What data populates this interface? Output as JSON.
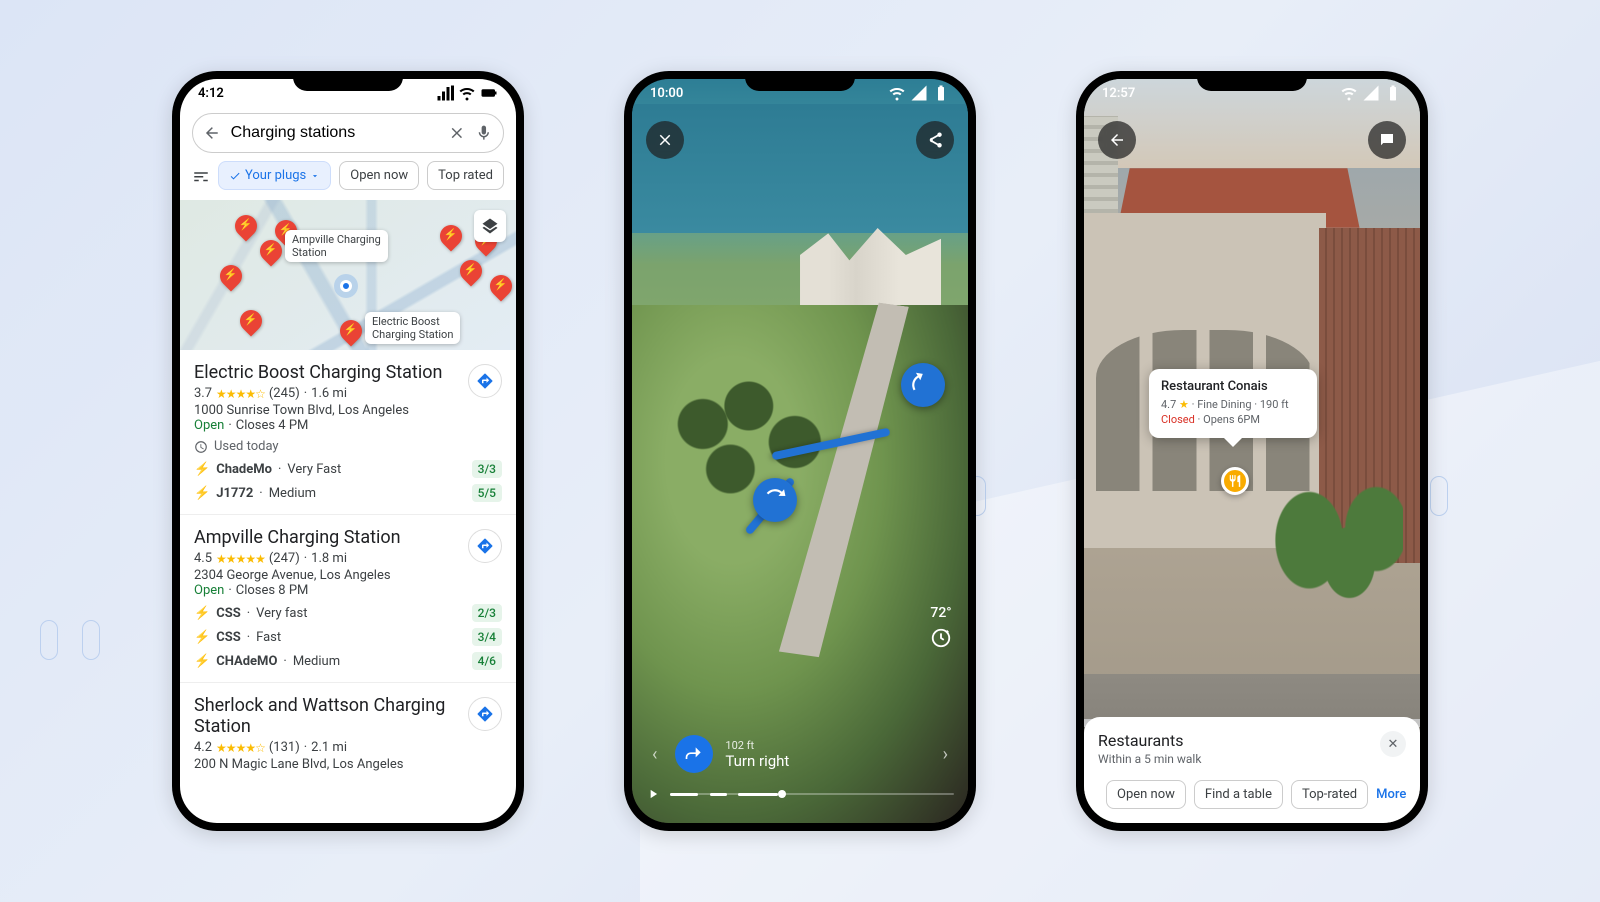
{
  "phone1": {
    "statusbar": {
      "time": "4:12"
    },
    "search": {
      "value": "Charging stations"
    },
    "filters": {
      "active": "Your plugs",
      "open_now": "Open now",
      "top_rated": "Top rated"
    },
    "map_labels": {
      "ampville": "Ampville Charging\nStation",
      "electric": "Electric Boost\nCharging Station"
    },
    "results": [
      {
        "name": "Electric Boost Charging Station",
        "rating": "3.7",
        "reviews": "(245)",
        "dist": "1.6 mi",
        "address": "1000 Sunrise Town Blvd, Los Angeles",
        "open": "Open",
        "hours": "Closes 4 PM",
        "usage": "Used today",
        "plugs": [
          {
            "name": "ChadeMo",
            "speed": "Very Fast",
            "avail": "3/3"
          },
          {
            "name": "J1772",
            "speed": "Medium",
            "avail": "5/5"
          }
        ]
      },
      {
        "name": "Ampville Charging Station",
        "rating": "4.5",
        "reviews": "(247)",
        "dist": "1.8 mi",
        "address": "2304 George Avenue, Los Angeles",
        "open": "Open",
        "hours": "Closes 8 PM",
        "plugs": [
          {
            "name": "CSS",
            "speed": "Very fast",
            "avail": "2/3"
          },
          {
            "name": "CSS",
            "speed": "Fast",
            "avail": "3/4"
          },
          {
            "name": "CHAdeMO",
            "speed": "Medium",
            "avail": "4/6"
          }
        ]
      },
      {
        "name": "Sherlock and Wattson Charging Station",
        "rating": "4.2",
        "reviews": "(131)",
        "dist": "2.1 mi",
        "address": "200 N Magic Lane Blvd, Los Angeles"
      }
    ]
  },
  "phone2": {
    "statusbar": {
      "time": "10:00"
    },
    "weather": {
      "temp": "72°"
    },
    "instruction": {
      "distance": "102 ft",
      "text": "Turn right"
    }
  },
  "phone3": {
    "statusbar": {
      "time": "12:57"
    },
    "place": {
      "name": "Restaurant Conais",
      "rating": "4.7",
      "category": "Fine Dining",
      "dist": "190 ft",
      "status": "Closed",
      "opens": "Opens 6PM"
    },
    "sheet": {
      "title": "Restaurants",
      "subtitle": "Within a 5 min walk",
      "chips": {
        "open_now": "Open now",
        "find_table": "Find a table",
        "top_rated": "Top-rated",
        "more": "More"
      }
    }
  }
}
